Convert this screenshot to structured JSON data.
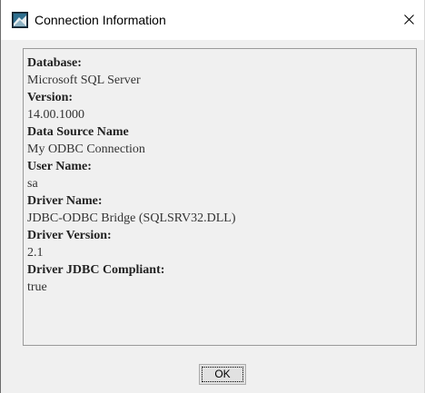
{
  "window": {
    "title": "Connection Information",
    "app_icon": "java-app-icon",
    "close_icon": "close-icon"
  },
  "info": [
    {
      "label": "Database:",
      "value": "Microsoft SQL Server"
    },
    {
      "label": "Version:",
      "value": "14.00.1000"
    },
    {
      "label": "Data Source Name",
      "value": "My ODBC Connection"
    },
    {
      "label": "User Name:",
      "value": "sa"
    },
    {
      "label": "Driver Name:",
      "value": "JDBC-ODBC Bridge (SQLSRV32.DLL)"
    },
    {
      "label": "Driver Version:",
      "value": "2.1"
    },
    {
      "label": "Driver JDBC Compliant:",
      "value": "true"
    }
  ],
  "buttons": {
    "ok_label": "OK"
  },
  "colors": {
    "dialog_background": "#f0f0f0",
    "titlebar_background": "#ffffff",
    "panel_border": "#9a9a9a"
  }
}
